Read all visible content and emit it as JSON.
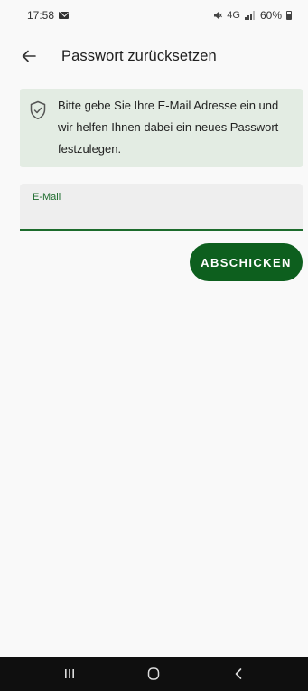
{
  "status_bar": {
    "time": "17:58",
    "notification_icon": "mail-icon",
    "network_text": "4G",
    "battery": "60%"
  },
  "app_bar": {
    "back_icon": "arrow-left-icon",
    "title": "Passwort zurücksetzen"
  },
  "info_banner": {
    "icon": "shield-check-icon",
    "text": "Bitte gebe Sie Ihre E-Mail Adresse ein und wir helfen Ihnen dabei ein neues Passwort festzulegen."
  },
  "email_field": {
    "label": "E-Mail",
    "value": ""
  },
  "submit_button": {
    "label": "ABSCHICKEN"
  },
  "nav_bar": {
    "recents_icon": "recents-icon",
    "home_icon": "home-icon",
    "back_icon": "nav-back-icon"
  },
  "colors": {
    "primary": "#0d5f1e",
    "banner_bg": "#e3ece3",
    "background": "#f9f9f9"
  }
}
